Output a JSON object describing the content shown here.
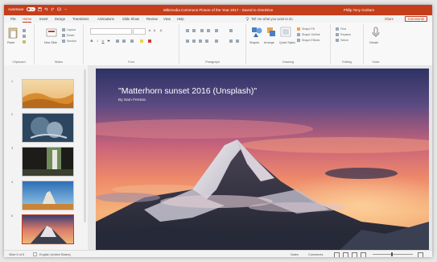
{
  "titlebar": {
    "autosave_label": "AutoSave",
    "autosave_state": "On",
    "title": "Wikimedia Commons Picture of the Year 2017 - Saved to OneDrive",
    "user": "Philip Tony Graham",
    "accent": "#c43e1c"
  },
  "tabs": [
    "File",
    "Home",
    "Insert",
    "Design",
    "Transitions",
    "Animations",
    "Slide Show",
    "Review",
    "View",
    "Help"
  ],
  "tellme": "Tell me what you want to do",
  "share_label": "Share",
  "comments_label": "Comments",
  "ribbon": {
    "clipboard": {
      "paste_label": "Paste",
      "group_label": "Clipboard"
    },
    "slides": {
      "new_slide_label": "New Slide",
      "layout_label": "Layout",
      "reset_label": "Reset",
      "section_label": "Section",
      "group_label": "Slides"
    },
    "font": {
      "group_label": "Font",
      "bold": "B",
      "italic": "I",
      "underline": "U",
      "strike": "S"
    },
    "paragraph": {
      "group_label": "Paragraph"
    },
    "drawing": {
      "shapes_label": "Shapes",
      "arrange_label": "Arrange",
      "quick_styles_label": "Quick Styles",
      "fill_label": "Shape Fill",
      "outline_label": "Shape Outline",
      "effects_label": "Shape Effects",
      "group_label": "Drawing"
    },
    "editing": {
      "find_label": "Find",
      "replace_label": "Replace",
      "select_label": "Select",
      "group_label": "Editing"
    },
    "voice": {
      "dictate_label": "Dictate",
      "group_label": "Voice"
    }
  },
  "thumbnails": [
    {
      "num": "1"
    },
    {
      "num": "2"
    },
    {
      "num": "3"
    },
    {
      "num": "4"
    },
    {
      "num": "5"
    }
  ],
  "slide": {
    "title": "\"Matterhorn sunset 2016 (Unsplash)\"",
    "subtitle": "By Sam Ferrara"
  },
  "status": {
    "slide_counter": "Slide 5 of 5",
    "language": "English (United States)",
    "notes": "Notes",
    "comments": "Comments"
  }
}
